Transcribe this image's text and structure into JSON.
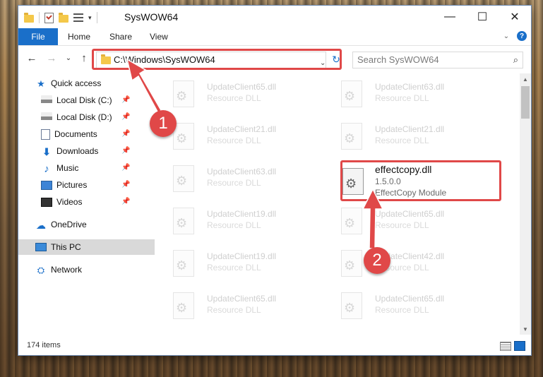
{
  "window": {
    "title": "SysWOW64",
    "controls": {
      "minimize": "—",
      "maximize": "☐",
      "close": "✕"
    }
  },
  "ribbon": {
    "tabs": [
      {
        "label": "File"
      },
      {
        "label": "Home"
      },
      {
        "label": "Share"
      },
      {
        "label": "View"
      }
    ]
  },
  "navigation": {
    "address": "C:\\Windows\\SysWOW64",
    "search_placeholder": "Search SysWOW64"
  },
  "sidebar": {
    "items": [
      {
        "label": "Quick access",
        "icon": "star-icon",
        "pinned": false
      },
      {
        "label": "Local Disk (C:)",
        "icon": "drive-icon",
        "pinned": true
      },
      {
        "label": "Local Disk (D:)",
        "icon": "drive-icon",
        "pinned": true
      },
      {
        "label": "Documents",
        "icon": "document-icon",
        "pinned": true
      },
      {
        "label": "Downloads",
        "icon": "download-icon",
        "pinned": true
      },
      {
        "label": "Music",
        "icon": "music-icon",
        "pinned": true
      },
      {
        "label": "Pictures",
        "icon": "pictures-icon",
        "pinned": true
      },
      {
        "label": "Videos",
        "icon": "videos-icon",
        "pinned": true
      },
      {
        "label": "OneDrive",
        "icon": "cloud-icon",
        "pinned": false
      },
      {
        "label": "This PC",
        "icon": "pc-icon",
        "pinned": false,
        "selected": true
      },
      {
        "label": "Network",
        "icon": "network-icon",
        "pinned": false
      }
    ]
  },
  "files": [
    {
      "name": "UpdateClient65.dll",
      "type": "Resource DLL"
    },
    {
      "name": "UpdateClient63.dll",
      "type": "Resource DLL"
    },
    {
      "name": "UpdateClient21.dll",
      "type": "Resource DLL"
    },
    {
      "name": "UpdateClient21.dll",
      "type": "Resource DLL"
    },
    {
      "name": "UpdateClient63.dll",
      "type": "Resource DLL"
    },
    {
      "name": "effectcopy.dll",
      "version": "1.5.0.0",
      "type": "EffectCopy Module",
      "highlighted": true
    },
    {
      "name": "UpdateClient19.dll",
      "type": "Resource DLL"
    },
    {
      "name": "UpdateClient65.dll",
      "type": "Resource DLL"
    },
    {
      "name": "UpdateClient19.dll",
      "type": "Resource DLL"
    },
    {
      "name": "UpdateClient42.dll",
      "type": "Resource DLL"
    },
    {
      "name": "UpdateClient65.dll",
      "type": "Resource DLL"
    },
    {
      "name": "UpdateClient65.dll",
      "type": "Resource DLL"
    }
  ],
  "status": {
    "item_count": "174 items"
  },
  "annotations": {
    "step1": "1",
    "step2": "2",
    "highlight_color": "#e04848"
  }
}
